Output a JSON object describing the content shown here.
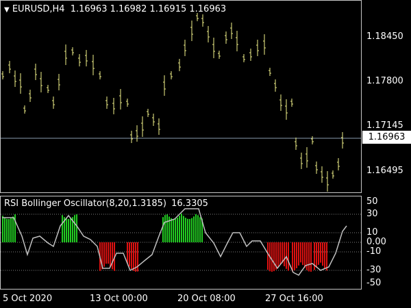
{
  "main_header": {
    "triangle": "▼",
    "symbol": "EURUSD,H4",
    "ohlc": "1.16963 1.16982 1.16915 1.16963"
  },
  "main_axis": [
    "1.18450",
    "1.17800",
    "1.17145",
    "1.16495"
  ],
  "current_price": "1.16963",
  "indicator_header": {
    "name": "RSI Bollinger Oscillator(8,20,1.3185)",
    "value": "16.3305"
  },
  "indicator_axis": [
    "50",
    "30",
    "10",
    "0.00",
    "-10",
    "-30",
    "-50"
  ],
  "time_axis": [
    "5 Oct 2020",
    "13 Oct 00:00",
    "20 Oct 08:00",
    "27 Oct 16:00"
  ],
  "colors": {
    "background": "#000000",
    "candles": "#f2f28a",
    "oscillator_line": "#c0c0c0",
    "up_histogram": "#22cc22",
    "down_histogram": "#dd1111",
    "grid": "#808080"
  }
}
